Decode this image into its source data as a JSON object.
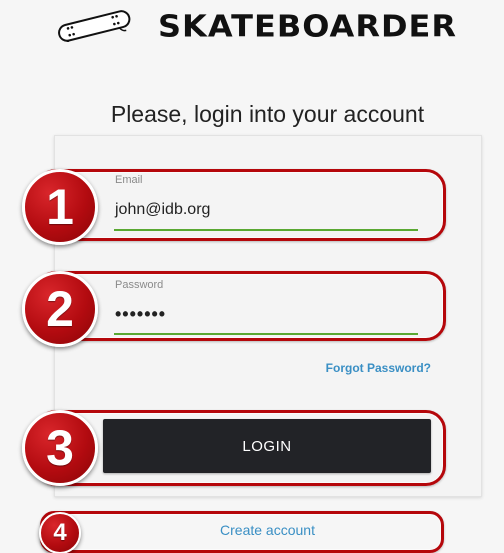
{
  "header": {
    "brand": "SKATEBOARDER",
    "logo_icon": "skateboard-icon"
  },
  "login": {
    "heading": "Please, login into your account",
    "email": {
      "label": "Email",
      "value": "john@idb.org"
    },
    "password": {
      "label": "Password",
      "value": "•••••••"
    },
    "forgot_label": "Forgot Password?",
    "submit_label": "LOGIN",
    "create_account_label": "Create account"
  },
  "annotations": {
    "badge_1": "1",
    "badge_2": "2",
    "badge_3": "3",
    "badge_4": "4"
  },
  "colors": {
    "accent_link": "#3a8fc4",
    "field_underline": "#5aa832",
    "button_bg": "#222327",
    "annotation_red": "#b5070b"
  }
}
